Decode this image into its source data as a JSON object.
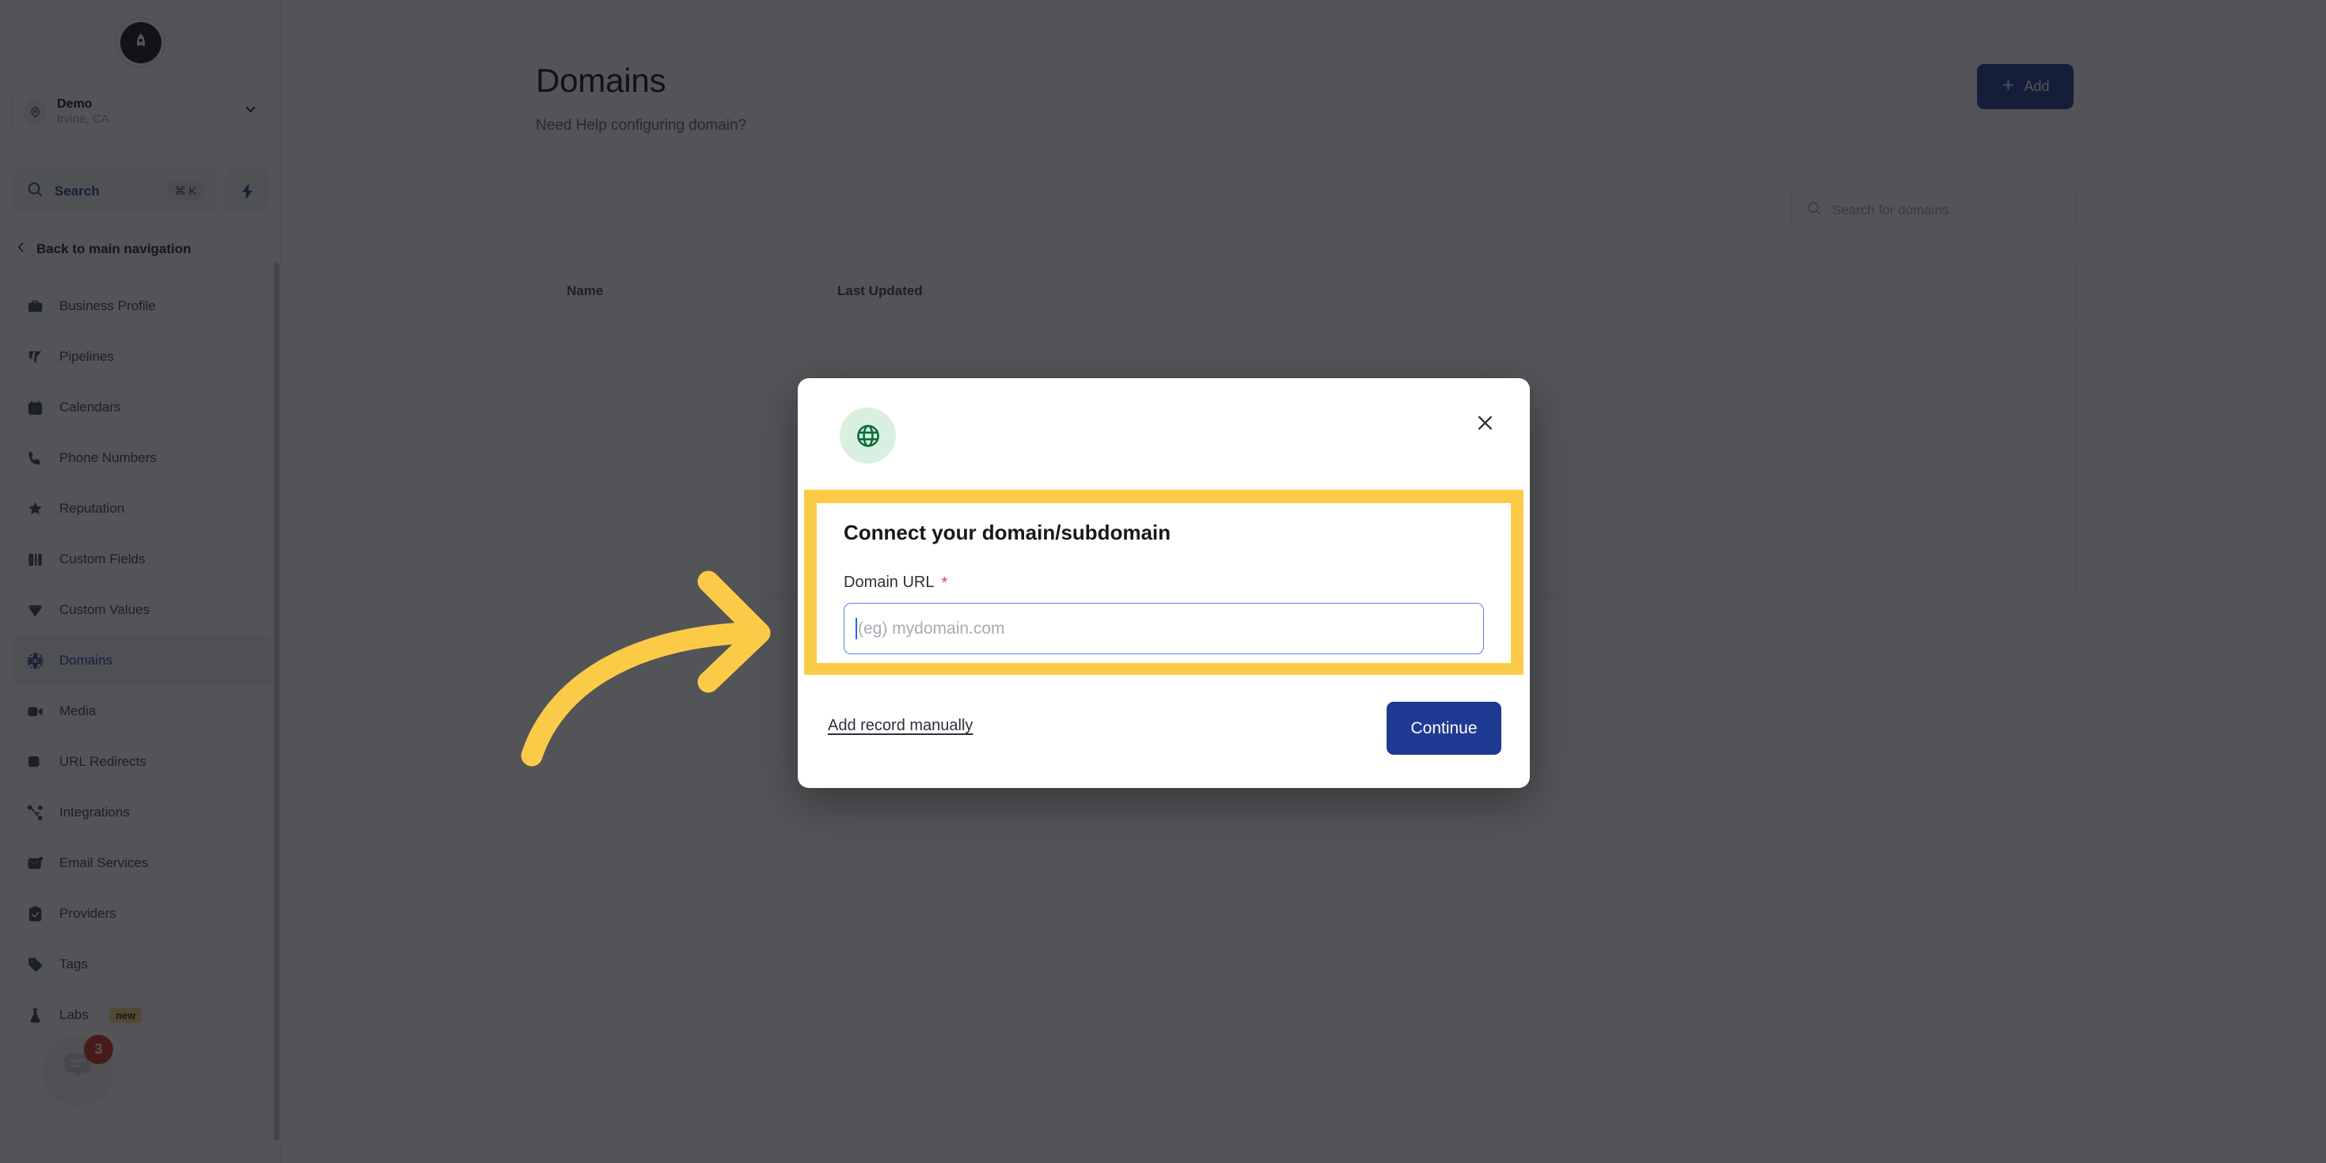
{
  "sidebar": {
    "logo_icon": "rocket-logo-icon",
    "location": {
      "avatar_icon": "map-pin-icon",
      "name": "Demo",
      "sub": "Irvine, CA",
      "chevron_icon": "chevron-down-icon"
    },
    "search": {
      "icon": "search-icon",
      "label": "Search",
      "shortcut": "⌘ K",
      "bolt_icon": "lightning-bolt-icon"
    },
    "back": {
      "icon": "chevron-left-icon",
      "label": "Back to main navigation"
    },
    "items": [
      {
        "label": "Business Profile",
        "icon": "briefcase-icon",
        "active": false
      },
      {
        "label": "Pipelines",
        "icon": "funnel-icon",
        "active": false
      },
      {
        "label": "Calendars",
        "icon": "calendar-icon",
        "active": false
      },
      {
        "label": "Phone Numbers",
        "icon": "phone-icon",
        "active": false
      },
      {
        "label": "Reputation",
        "icon": "star-icon",
        "active": false
      },
      {
        "label": "Custom Fields",
        "icon": "columns-icon",
        "active": false
      },
      {
        "label": "Custom Values",
        "icon": "gem-icon",
        "active": false
      },
      {
        "label": "Domains",
        "icon": "globe-grid-icon",
        "active": true
      },
      {
        "label": "Media",
        "icon": "video-icon",
        "active": false
      },
      {
        "label": "URL Redirects",
        "icon": "cursor-box-icon",
        "active": false
      },
      {
        "label": "Integrations",
        "icon": "nodes-icon",
        "active": false
      },
      {
        "label": "Email Services",
        "icon": "envelope-icon",
        "active": false
      },
      {
        "label": "Providers",
        "icon": "clipboard-check-icon",
        "active": false
      },
      {
        "label": "Tags",
        "icon": "tag-icon",
        "active": false
      },
      {
        "label": "Labs",
        "icon": "flask-icon",
        "active": false,
        "badge": "new"
      }
    ],
    "chat": {
      "icon": "chat-bubble-icon",
      "count": "3"
    }
  },
  "main": {
    "title": "Domains",
    "subtitle": "Need Help configuring domain?",
    "add_button": {
      "label": "Add",
      "icon": "plus-icon"
    },
    "search": {
      "icon": "search-icon",
      "placeholder": "Search for domains"
    },
    "table": {
      "columns": [
        "Name",
        "Last Updated"
      ],
      "rows": []
    }
  },
  "modal": {
    "header_icon": "globe-icon",
    "close_icon": "close-icon",
    "title": "Connect your domain/subdomain",
    "field": {
      "label": "Domain URL",
      "required_marker": "*",
      "value": "",
      "placeholder": "(eg) mydomain.com"
    },
    "manual_link": "Add record manually",
    "continue_button": "Continue"
  },
  "annotation": {
    "arrow_icon": "curved-arrow-right-icon",
    "arrow_color": "#fbcb48",
    "highlight_color": "#fbcb48"
  },
  "colors": {
    "accent_blue": "#1f3a93",
    "sidebar_active_text": "#2b3a8f",
    "highlight_yellow": "#fbcb48",
    "required_red": "#e0414d",
    "badge_red": "#d93025",
    "globe_green": "#0d6b38"
  }
}
